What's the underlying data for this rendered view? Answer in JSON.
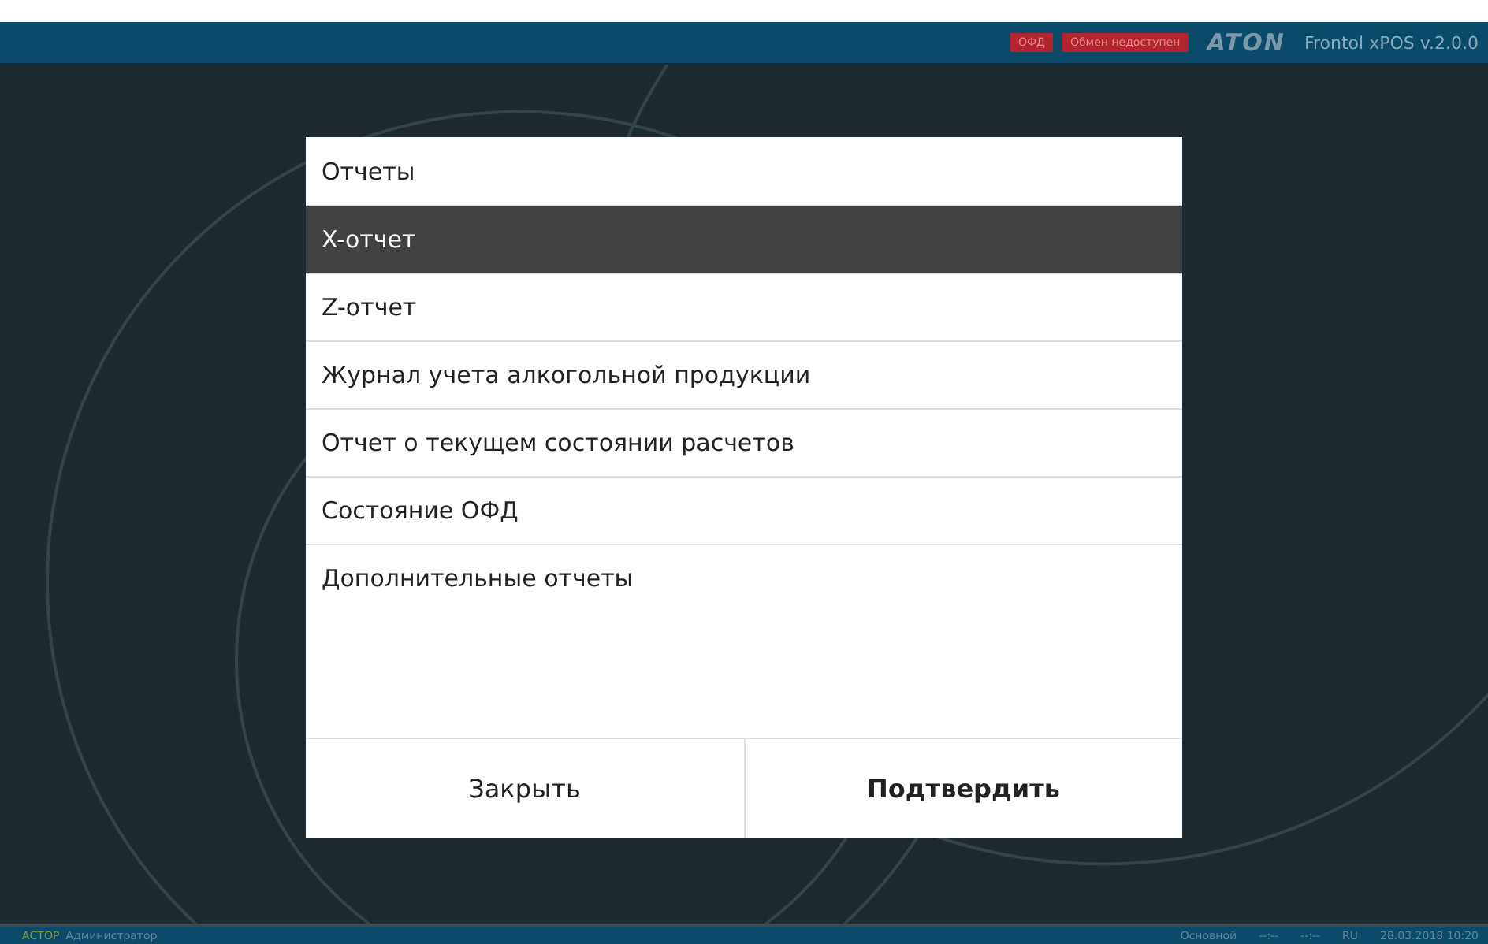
{
  "top_bar": {
    "badges": [
      "ОФД",
      "Обмен недоступен"
    ],
    "logo": "ATON",
    "app_title": "Frontol xPOS v.2.0.0"
  },
  "dialog": {
    "title": "Отчеты",
    "items": [
      {
        "label": "X-отчет",
        "selected": true
      },
      {
        "label": "Z-отчет",
        "selected": false
      },
      {
        "label": "Журнал учета алкогольной продукции",
        "selected": false
      },
      {
        "label": "Отчет о текущем состоянии расчетов",
        "selected": false
      },
      {
        "label": "Состояние ОФД",
        "selected": false
      },
      {
        "label": "Дополнительные отчеты",
        "selected": false
      }
    ],
    "buttons": [
      {
        "label": "Закрыть",
        "kind": "secondary"
      },
      {
        "label": "Подтвердить",
        "kind": "primary"
      }
    ]
  },
  "status_bar": {
    "company": "АСТОР",
    "user": "Администратор",
    "mode": "Основной",
    "field_1": "--:--",
    "field_2": "--:--",
    "language": "RU",
    "datetime": "28.03.2018 10:20"
  }
}
